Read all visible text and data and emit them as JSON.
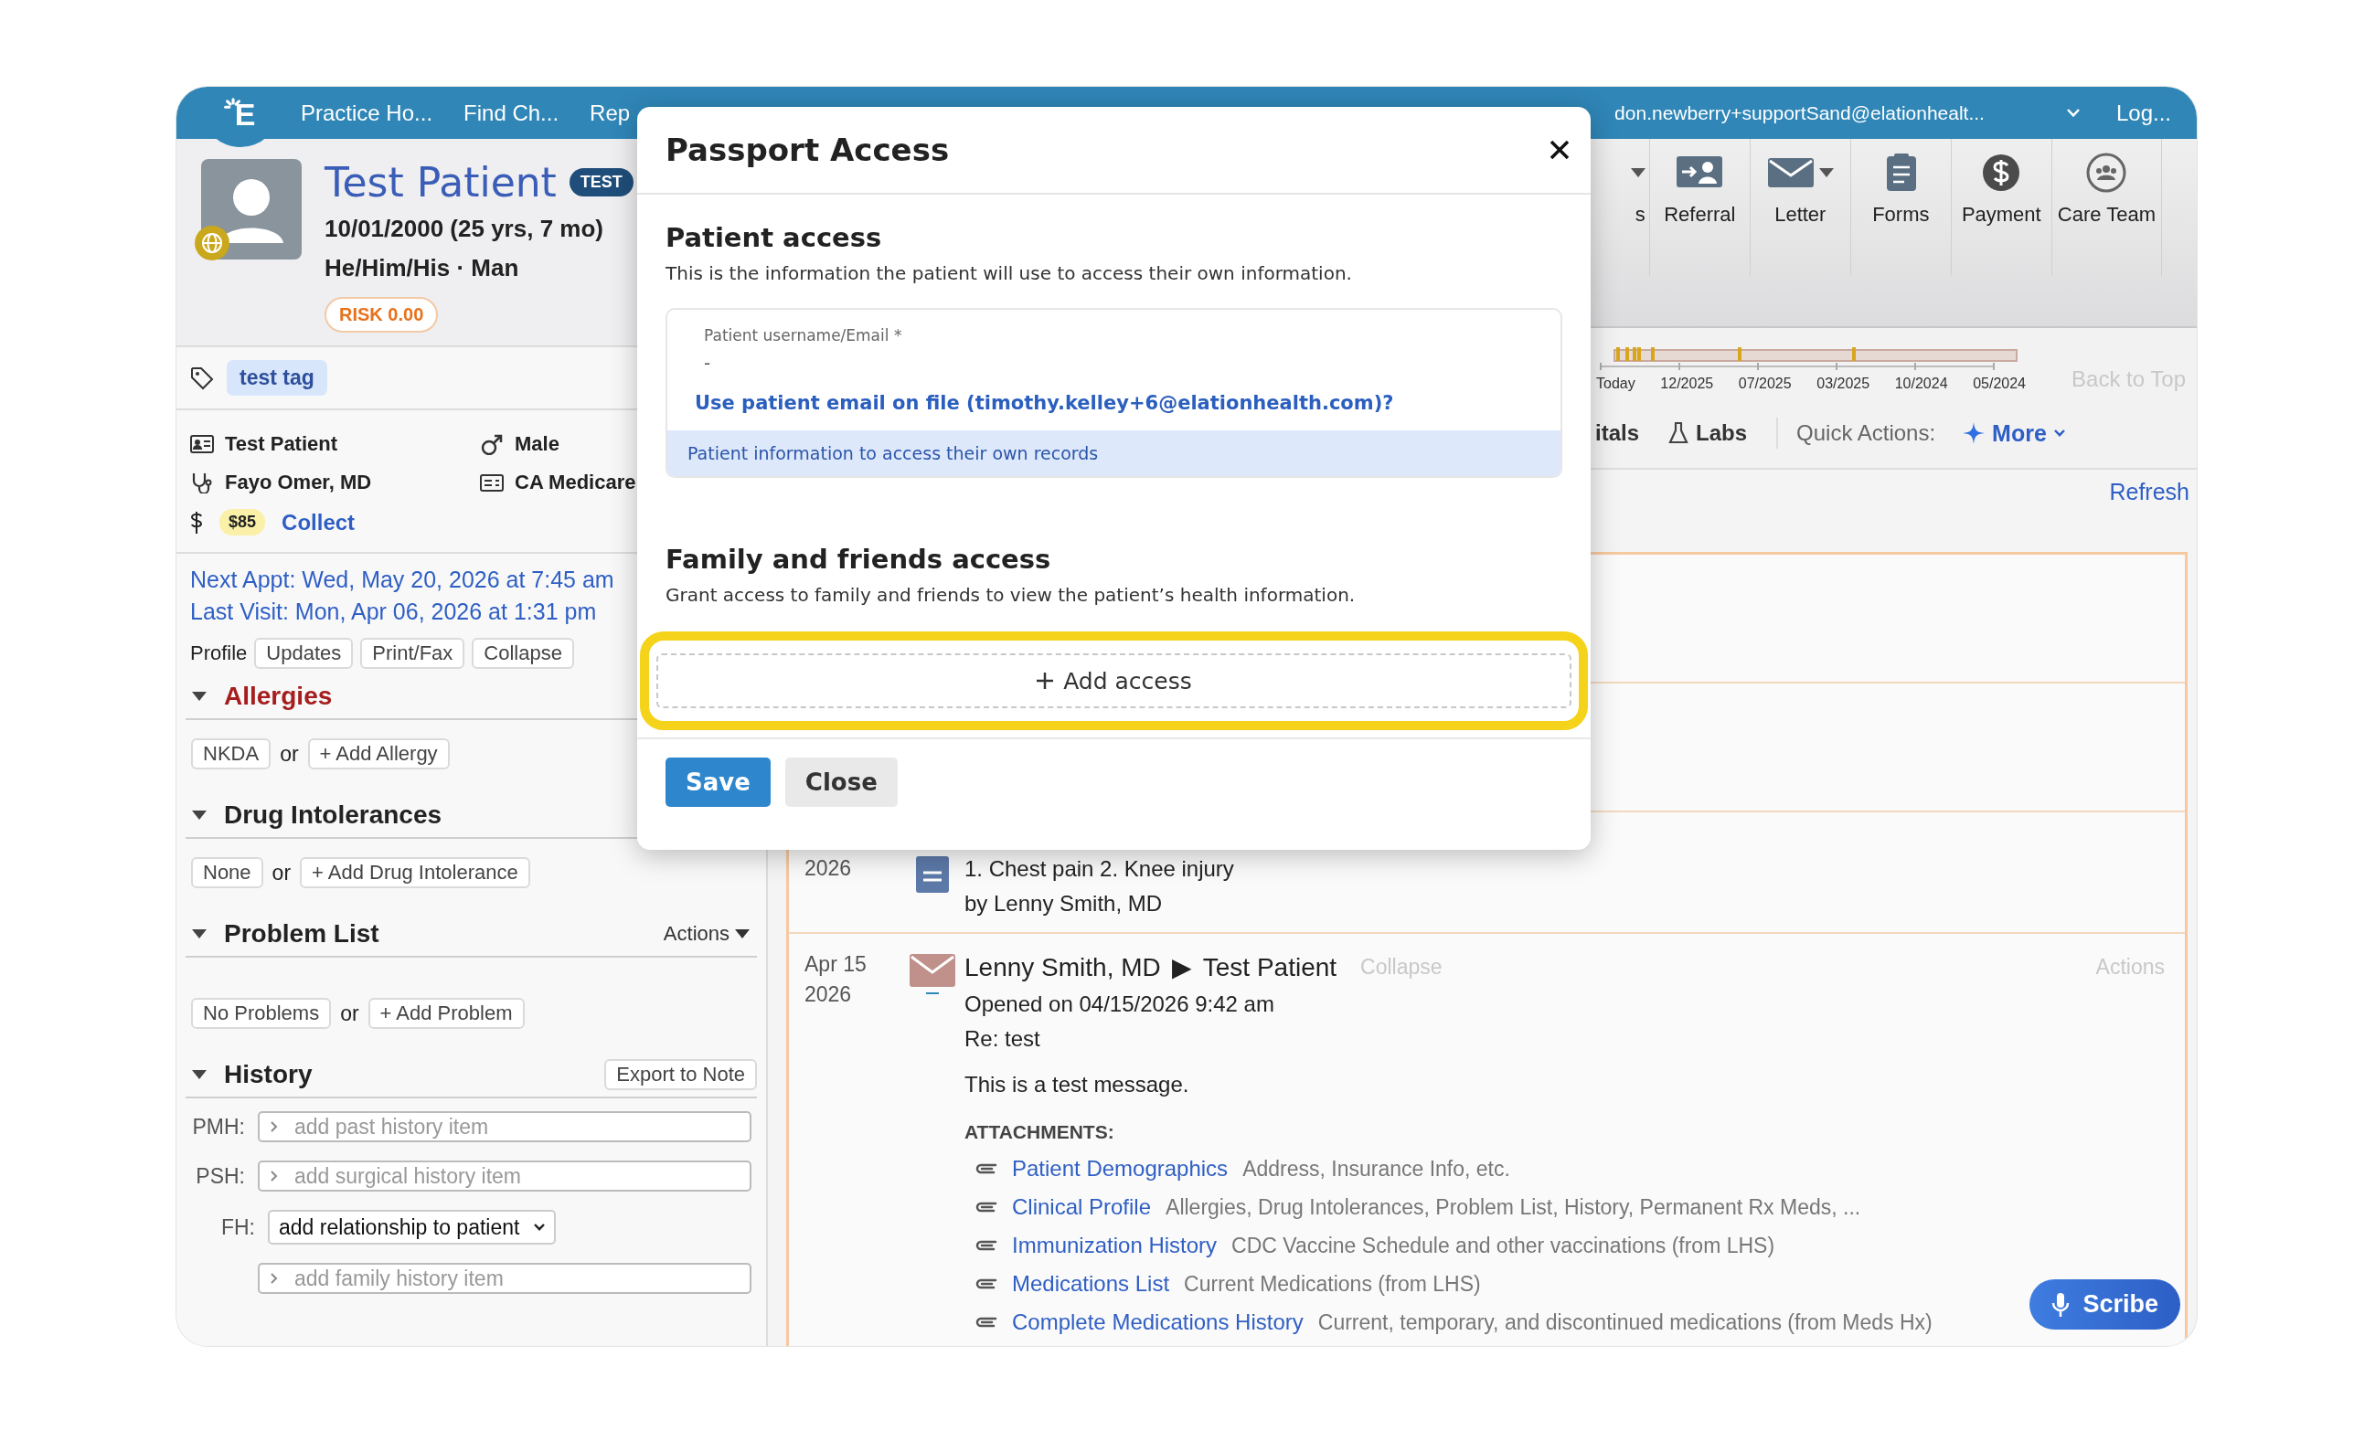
{
  "top_nav": {
    "logo": "E",
    "items": [
      "Practice Ho...",
      "Find Ch...",
      "Rep"
    ],
    "account": "don.newberry+supportSand@elationhealt...",
    "logout": "Log..."
  },
  "patient": {
    "name": "Test Patient",
    "badge": "TEST",
    "dob": "10/01/2000 (25 yrs, 7 mo)",
    "pronouns": "He/Him/His · Man",
    "risk": "RISK 0.00",
    "tag": "test tag",
    "info": [
      {
        "kind": "id",
        "text": "Test Patient"
      },
      {
        "kind": "sex",
        "text": "Male"
      },
      {
        "kind": "doctor",
        "text": "Fayo Omer, MD"
      },
      {
        "kind": "insurance",
        "text": "CA Medicare"
      }
    ],
    "balance": "$85",
    "collect": "Collect",
    "next_appt": "Next Appt: Wed, May 20, 2026 at 7:45 am",
    "last_visit": "Last Visit: Mon, Apr 06, 2026 at 1:31 pm",
    "profile_label": "Profile",
    "profile_buttons": [
      "Updates",
      "Print/Fax",
      "Collapse"
    ]
  },
  "sections": [
    {
      "title": "Allergies",
      "alert": true,
      "expanded": true,
      "chips": [
        "NKDA",
        "+ Add Allergy"
      ],
      "separator": "or"
    },
    {
      "title": "Drug Intolerances",
      "alert": false,
      "expanded": true,
      "chips": [
        "None",
        "+ Add Drug Intolerance"
      ],
      "separator": "or"
    },
    {
      "title": "Problem List",
      "alert": false,
      "expanded": true,
      "action": "Actions",
      "chips": [
        "No Problems",
        "+ Add Problem"
      ],
      "separator": "or"
    }
  ],
  "history": {
    "title": "History",
    "expanded": true,
    "action": "Export to Note",
    "rows": [
      {
        "kind": "field",
        "label": "PMH:",
        "placeholder": "add past history item"
      },
      {
        "kind": "field",
        "label": "PSH:",
        "placeholder": "add surgical history item"
      },
      {
        "kind": "select",
        "label": "FH:",
        "value": "add relationship to patient"
      },
      {
        "kind": "field",
        "placeholder": "add family history item"
      }
    ]
  },
  "toolbar": [
    {
      "label": "s",
      "kind": "plain",
      "caret": true
    },
    {
      "label": "Referral",
      "kind": "referral",
      "caret": false
    },
    {
      "label": "Letter",
      "kind": "letter",
      "caret": true
    },
    {
      "label": "Forms",
      "kind": "forms",
      "caret": false
    },
    {
      "label": "Payment",
      "kind": "payment",
      "caret": false
    },
    {
      "label": "Care Team",
      "kind": "team",
      "caret": false
    }
  ],
  "timeline": {
    "ticks": [
      "Today",
      "12/2025",
      "07/2025",
      "03/2025",
      "10/2024",
      "05/2024"
    ],
    "back_to_top": "Back to Top"
  },
  "tabs": [
    {
      "label": "itals",
      "kind": "plain"
    },
    {
      "label": "Labs",
      "kind": "labs"
    }
  ],
  "quick_actions": {
    "label": "Quick Actions:",
    "more": "More"
  },
  "refresh": "Refresh",
  "feed": [
    {
      "kind": "hidden"
    },
    {
      "kind": "hidden"
    },
    {
      "kind": "note",
      "year": "2026",
      "lines": [
        "1. Chest pain 2. Knee injury",
        "by Lenny Smith, MD"
      ]
    },
    {
      "kind": "letter",
      "date": "Apr 15",
      "year": "2026",
      "from": "Lenny Smith, MD",
      "arrow": "▶",
      "to": "Test Patient",
      "collapse": "Collapse",
      "actions": "Actions",
      "opened": "Opened on 04/15/2026 9:42 am",
      "re": "Re: test",
      "body": "This is a test message.",
      "attachments_label": "ATTACHMENTS:",
      "attachments": [
        {
          "name": "Patient Demographics",
          "desc": "Address, Insurance Info, etc."
        },
        {
          "name": "Clinical Profile",
          "desc": "Allergies, Drug Intolerances, Problem List, History, Permanent Rx Meds, ..."
        },
        {
          "name": "Immunization History",
          "desc": "CDC Vaccine Schedule and other vaccinations (from LHS)"
        },
        {
          "name": "Medications List",
          "desc": "Current Medications (from LHS)"
        },
        {
          "name": "Complete Medications History",
          "desc": "Current, temporary, and discontinued medications (from Meds Hx)"
        }
      ]
    }
  ],
  "scribe": "Scribe",
  "modal": {
    "title": "Passport Access",
    "patient_heading": "Patient access",
    "patient_desc": "This is the information the patient will use to access their own information.",
    "field_label": "Patient username/Email *",
    "field_value": "-",
    "email_link": "Use patient email on file (timothy.kelley+6@elationhealth.com)?",
    "info": "Patient information to access their own records",
    "family_heading": "Family and friends access",
    "family_desc": "Grant access to family and friends to view the patient’s health information.",
    "add_access": "Add access",
    "highlighted": true,
    "buttons": [
      {
        "label": "Save",
        "kind": "primary"
      },
      {
        "label": "Close",
        "kind": "secondary"
      }
    ]
  }
}
